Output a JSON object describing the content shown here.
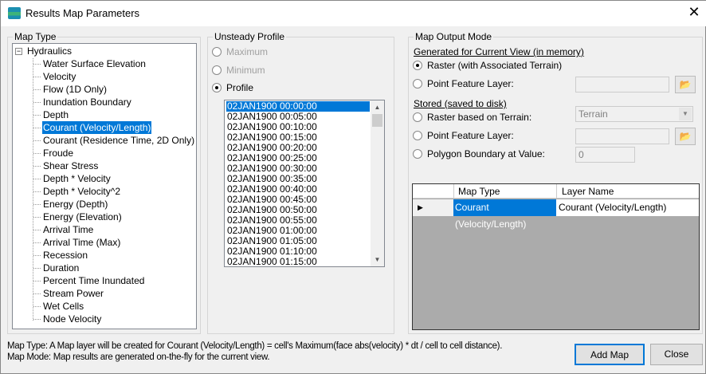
{
  "window": {
    "title": "Results Map Parameters",
    "close": "✕"
  },
  "map_type": {
    "legend": "Map Type",
    "root": "Hydraulics",
    "items": [
      "Water Surface Elevation",
      "Velocity",
      "Flow (1D Only)",
      "Inundation Boundary",
      "Depth",
      "Courant (Velocity/Length)",
      "Courant (Residence Time, 2D Only)",
      "Froude",
      "Shear Stress",
      "Depth * Velocity",
      "Depth * Velocity^2",
      "Energy (Depth)",
      "Energy (Elevation)",
      "Arrival Time",
      "Arrival Time (Max)",
      "Recession",
      "Duration",
      "Percent Time Inundated",
      "Stream Power",
      "Wet Cells",
      "Node Velocity"
    ],
    "selected_index": 5
  },
  "profile": {
    "legend": "Unsteady Profile",
    "maximum": "Maximum",
    "minimum": "Minimum",
    "profile": "Profile",
    "times": [
      "02JAN1900 00:00:00",
      "02JAN1900 00:05:00",
      "02JAN1900 00:10:00",
      "02JAN1900 00:15:00",
      "02JAN1900 00:20:00",
      "02JAN1900 00:25:00",
      "02JAN1900 00:30:00",
      "02JAN1900 00:35:00",
      "02JAN1900 00:40:00",
      "02JAN1900 00:45:00",
      "02JAN1900 00:50:00",
      "02JAN1900 00:55:00",
      "02JAN1900 01:00:00",
      "02JAN1900 01:05:00",
      "02JAN1900 01:10:00",
      "02JAN1900 01:15:00"
    ]
  },
  "output": {
    "legend": "Map Output Mode",
    "generated": "Generated for Current View (in memory)",
    "raster_assoc": "Raster (with Associated Terrain)",
    "point_layer": "Point Feature Layer:",
    "stored": "Stored (saved to disk)",
    "raster_terrain": "Raster based on Terrain:",
    "terrain_value": "Terrain",
    "point_layer2": "Point Feature Layer:",
    "polygon": "Polygon Boundary at Value:",
    "polygon_value": "0"
  },
  "grid": {
    "headers": [
      "Map Type",
      "Layer Name"
    ],
    "rows": [
      [
        "Courant (Velocity/Length)",
        "Courant (Velocity/Length)"
      ]
    ]
  },
  "footer": {
    "line1": "Map Type: A Map layer will be created for Courant (Velocity/Length) = cell's Maximum(face abs(velocity) * dt / cell to cell distance).",
    "line2": "Map Mode: Map results are generated on-the-fly for the current view.",
    "add_map": "Add Map",
    "close": "Close"
  }
}
